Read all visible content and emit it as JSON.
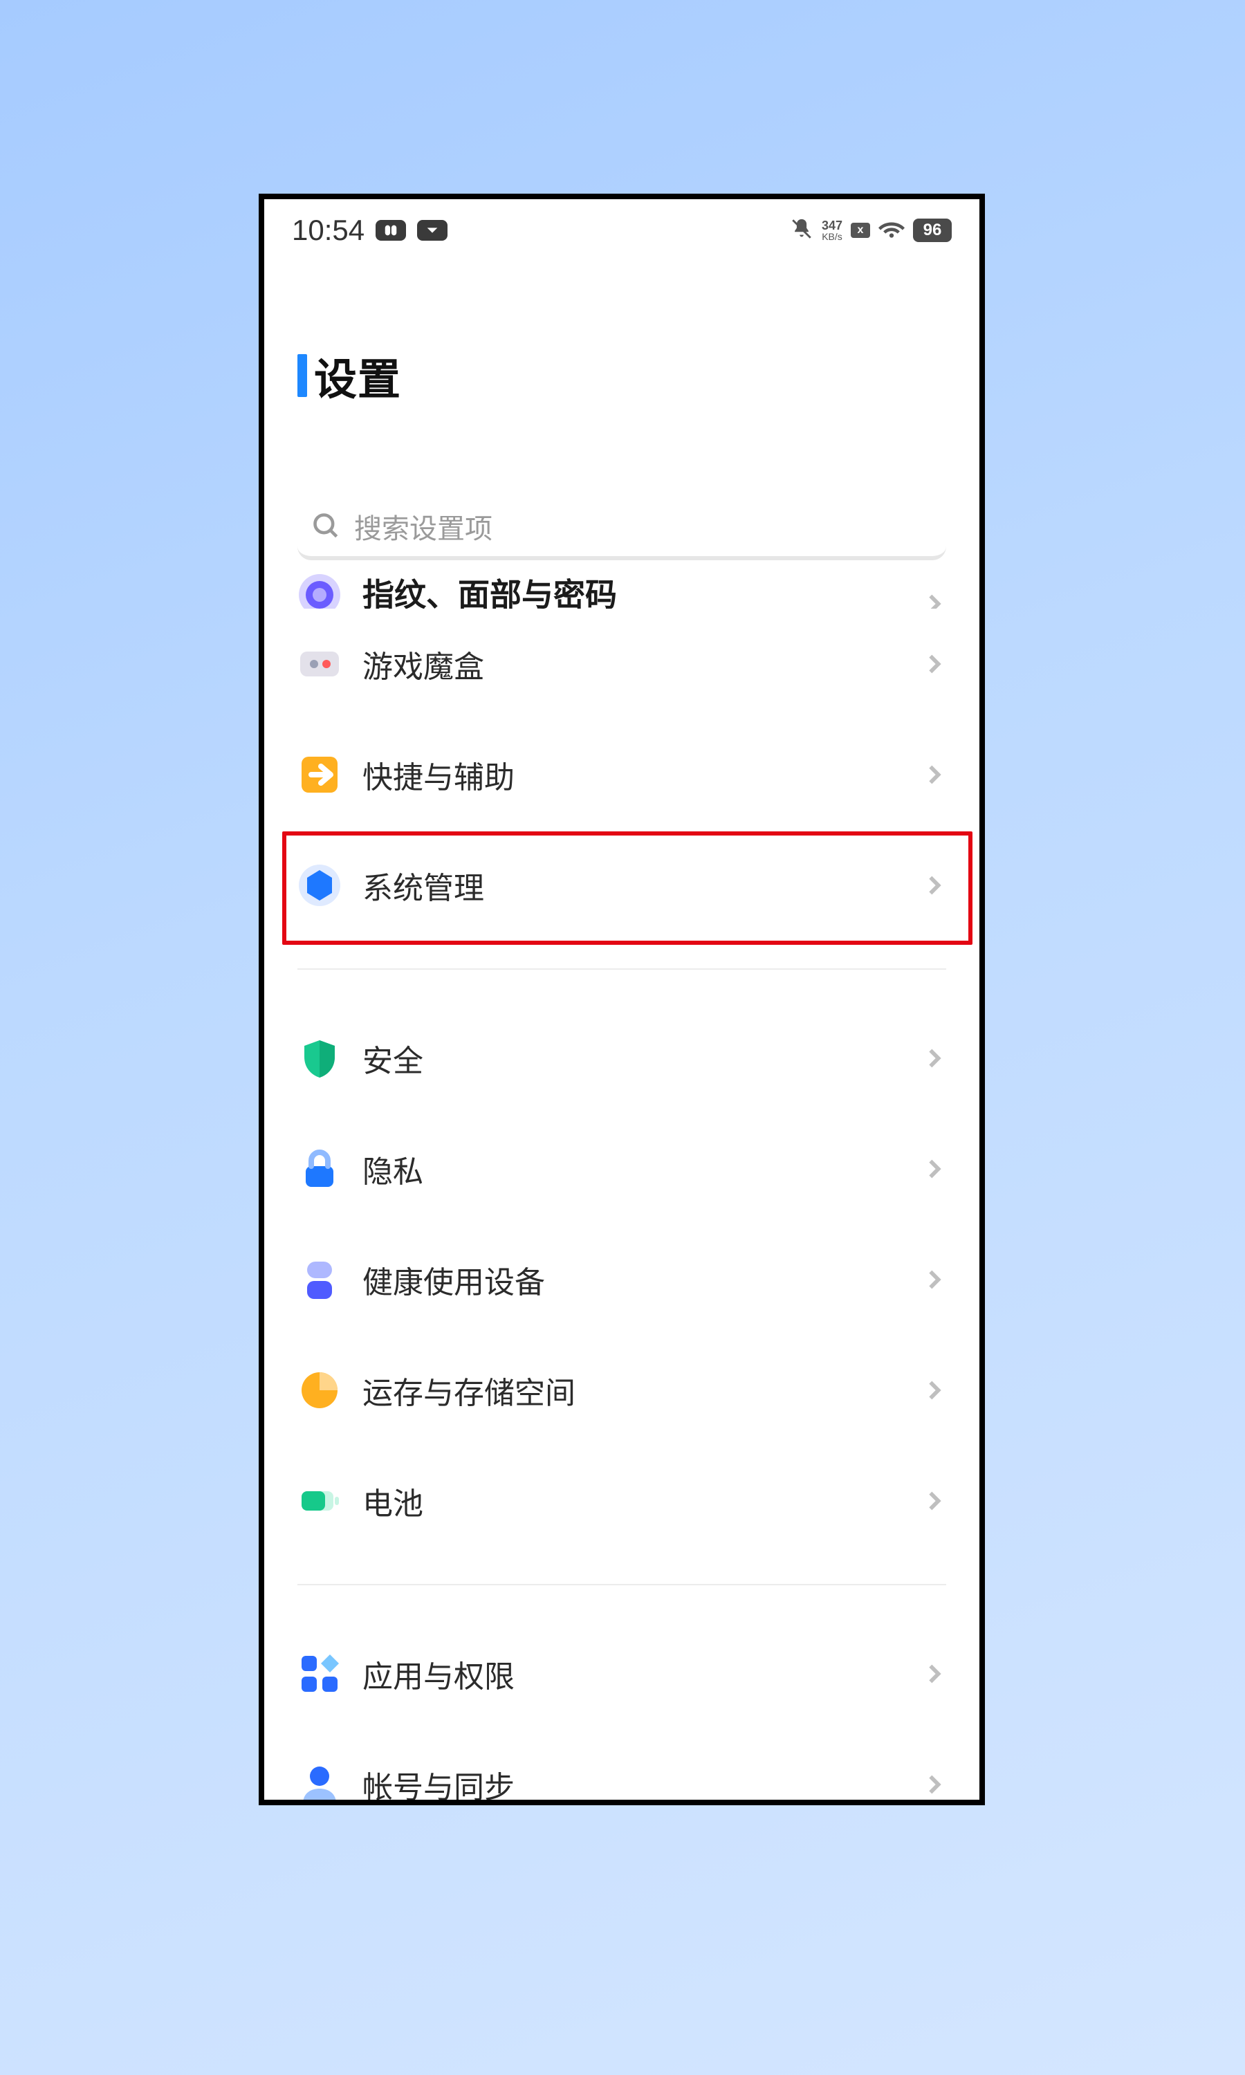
{
  "statusbar": {
    "time": "10:54",
    "net_speed_value": "347",
    "net_speed_unit": "KB/s",
    "sim_badge": "x",
    "battery_percent": "96"
  },
  "page": {
    "title": "设置"
  },
  "search": {
    "placeholder": "搜索设置项"
  },
  "groups": [
    {
      "items": [
        {
          "key": "fingerprint",
          "label": "指纹、面部与密码",
          "icon": "fingerprint-icon",
          "cutoff": true
        },
        {
          "key": "gamebox",
          "label": "游戏魔盒",
          "icon": "gamebox-icon"
        },
        {
          "key": "shortcut",
          "label": "快捷与辅助",
          "icon": "arrow-right-box-icon"
        },
        {
          "key": "system",
          "label": "系统管理",
          "icon": "hex-gear-icon",
          "highlighted": true
        }
      ]
    },
    {
      "items": [
        {
          "key": "security",
          "label": "安全",
          "icon": "shield-icon"
        },
        {
          "key": "privacy",
          "label": "隐私",
          "icon": "lock-icon"
        },
        {
          "key": "wellbeing",
          "label": "健康使用设备",
          "icon": "wellbeing-icon"
        },
        {
          "key": "storage",
          "label": "运存与存储空间",
          "icon": "pie-icon"
        },
        {
          "key": "battery",
          "label": "电池",
          "icon": "battery-icon"
        }
      ]
    },
    {
      "items": [
        {
          "key": "apps",
          "label": "应用与权限",
          "icon": "apps-icon"
        },
        {
          "key": "account",
          "label": "帐号与同步",
          "icon": "user-icon"
        }
      ]
    }
  ],
  "colors": {
    "accent": "#1e88ff",
    "highlight": "#e30613"
  }
}
